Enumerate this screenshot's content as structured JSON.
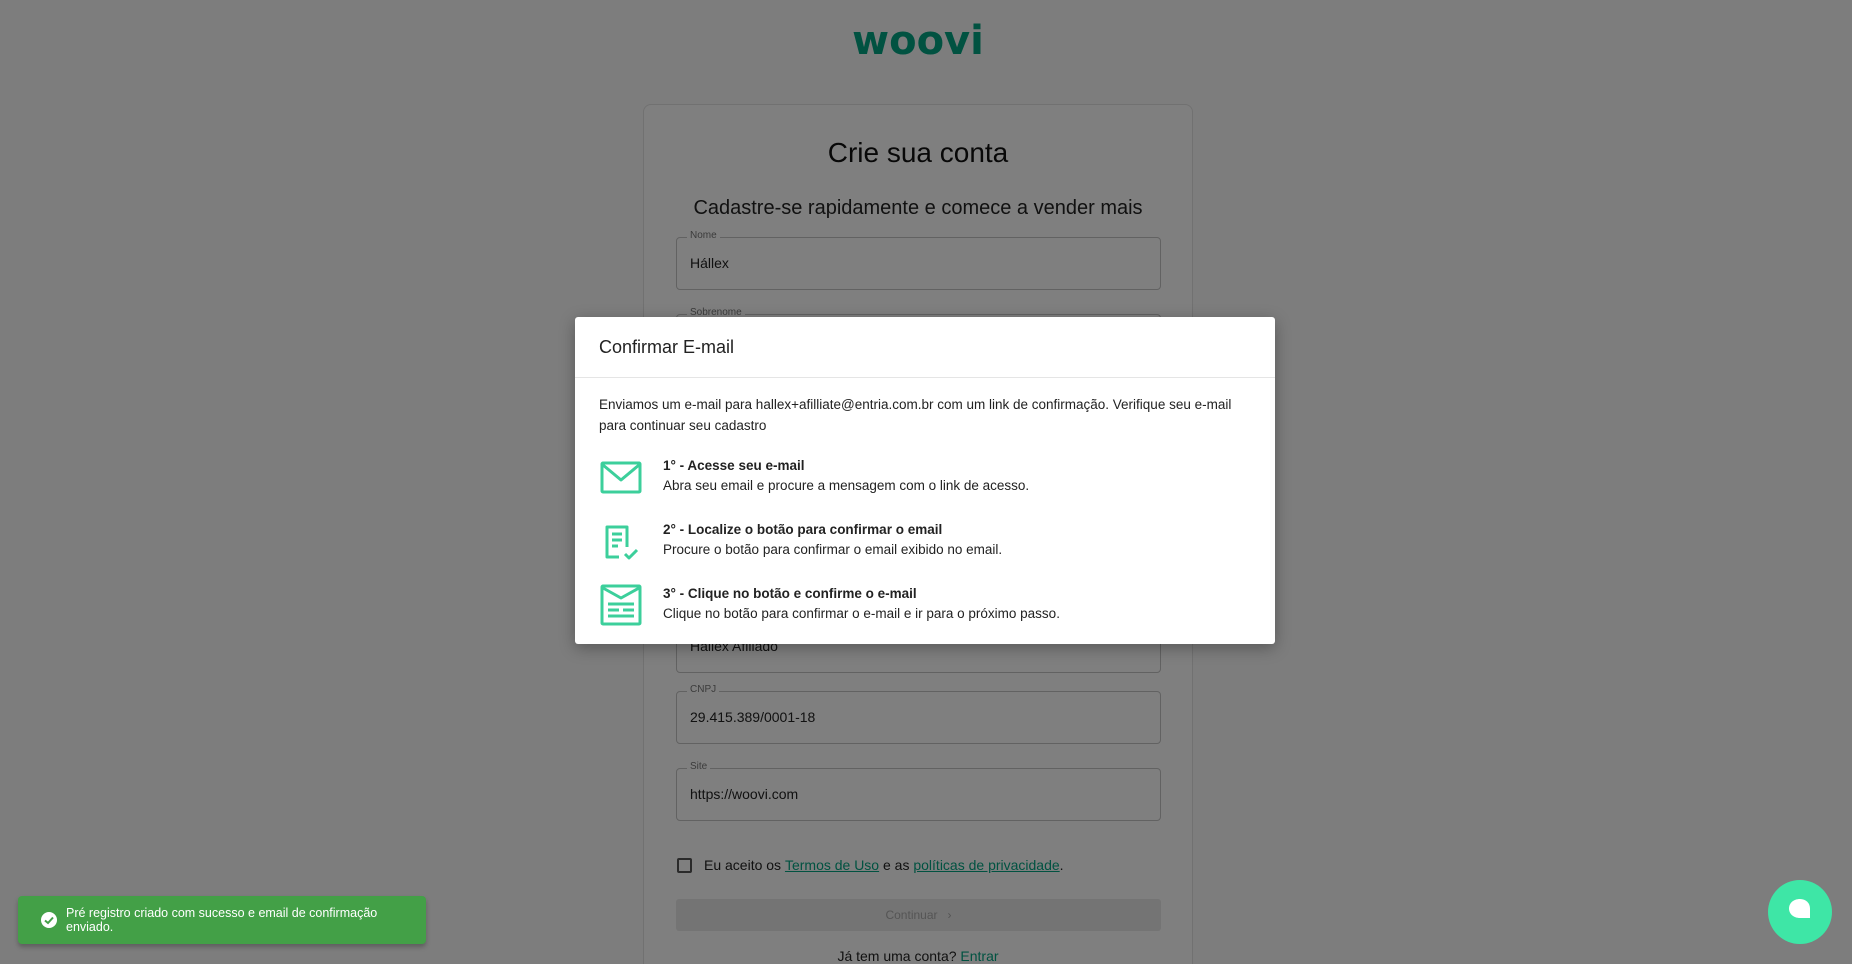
{
  "brand": {
    "logo_text": "woovi",
    "color": "#03a583"
  },
  "signup": {
    "title": "Crie sua conta",
    "subtitle": "Cadastre-se rapidamente e comece a vender mais",
    "fields": [
      {
        "label": "Nome",
        "value": "Hállex"
      },
      {
        "label": "Sobrenome",
        "value": ""
      },
      {
        "label": "",
        "value": "Hállex Afiliado"
      },
      {
        "label": "CNPJ",
        "value": "29.415.389/0001-18"
      },
      {
        "label": "Site",
        "value": "https://woovi.com"
      }
    ],
    "terms": {
      "prefix": "Eu aceito os ",
      "terms_link": "Termos de Uso",
      "middle": " e as ",
      "privacy_link": "políticas de privacidade",
      "suffix": "."
    },
    "continue_label": "Continuar",
    "login_prompt": "Já tem uma conta? ",
    "login_link": "Entrar"
  },
  "modal": {
    "title": "Confirmar E-mail",
    "description": "Enviamos um e-mail para hallex+afilliate@entria.com.br com um link de confirmação. Verifique seu e-mail para continuar seu cadastro",
    "steps": [
      {
        "icon": "envelope-icon",
        "title": "1° - Acesse seu e-mail",
        "desc": "Abra seu email e procure a mensagem com o link de acesso."
      },
      {
        "icon": "document-check-icon",
        "title": "2° - Localize o botão para confirmar o email",
        "desc": "Procure o botão para confirmar o email exibido no email."
      },
      {
        "icon": "email-list-icon",
        "title": "3° - Clique no botão e confirme o e-mail",
        "desc": "Clique no botão para confirmar o e-mail e ir para o próximo passo."
      }
    ]
  },
  "toast": {
    "message": "Pré registro criado com sucesso e email de confirmação enviado.",
    "color": "#43a047"
  },
  "chat": {
    "icon": "chat-bubble-icon",
    "color": "#3ee6a6"
  }
}
